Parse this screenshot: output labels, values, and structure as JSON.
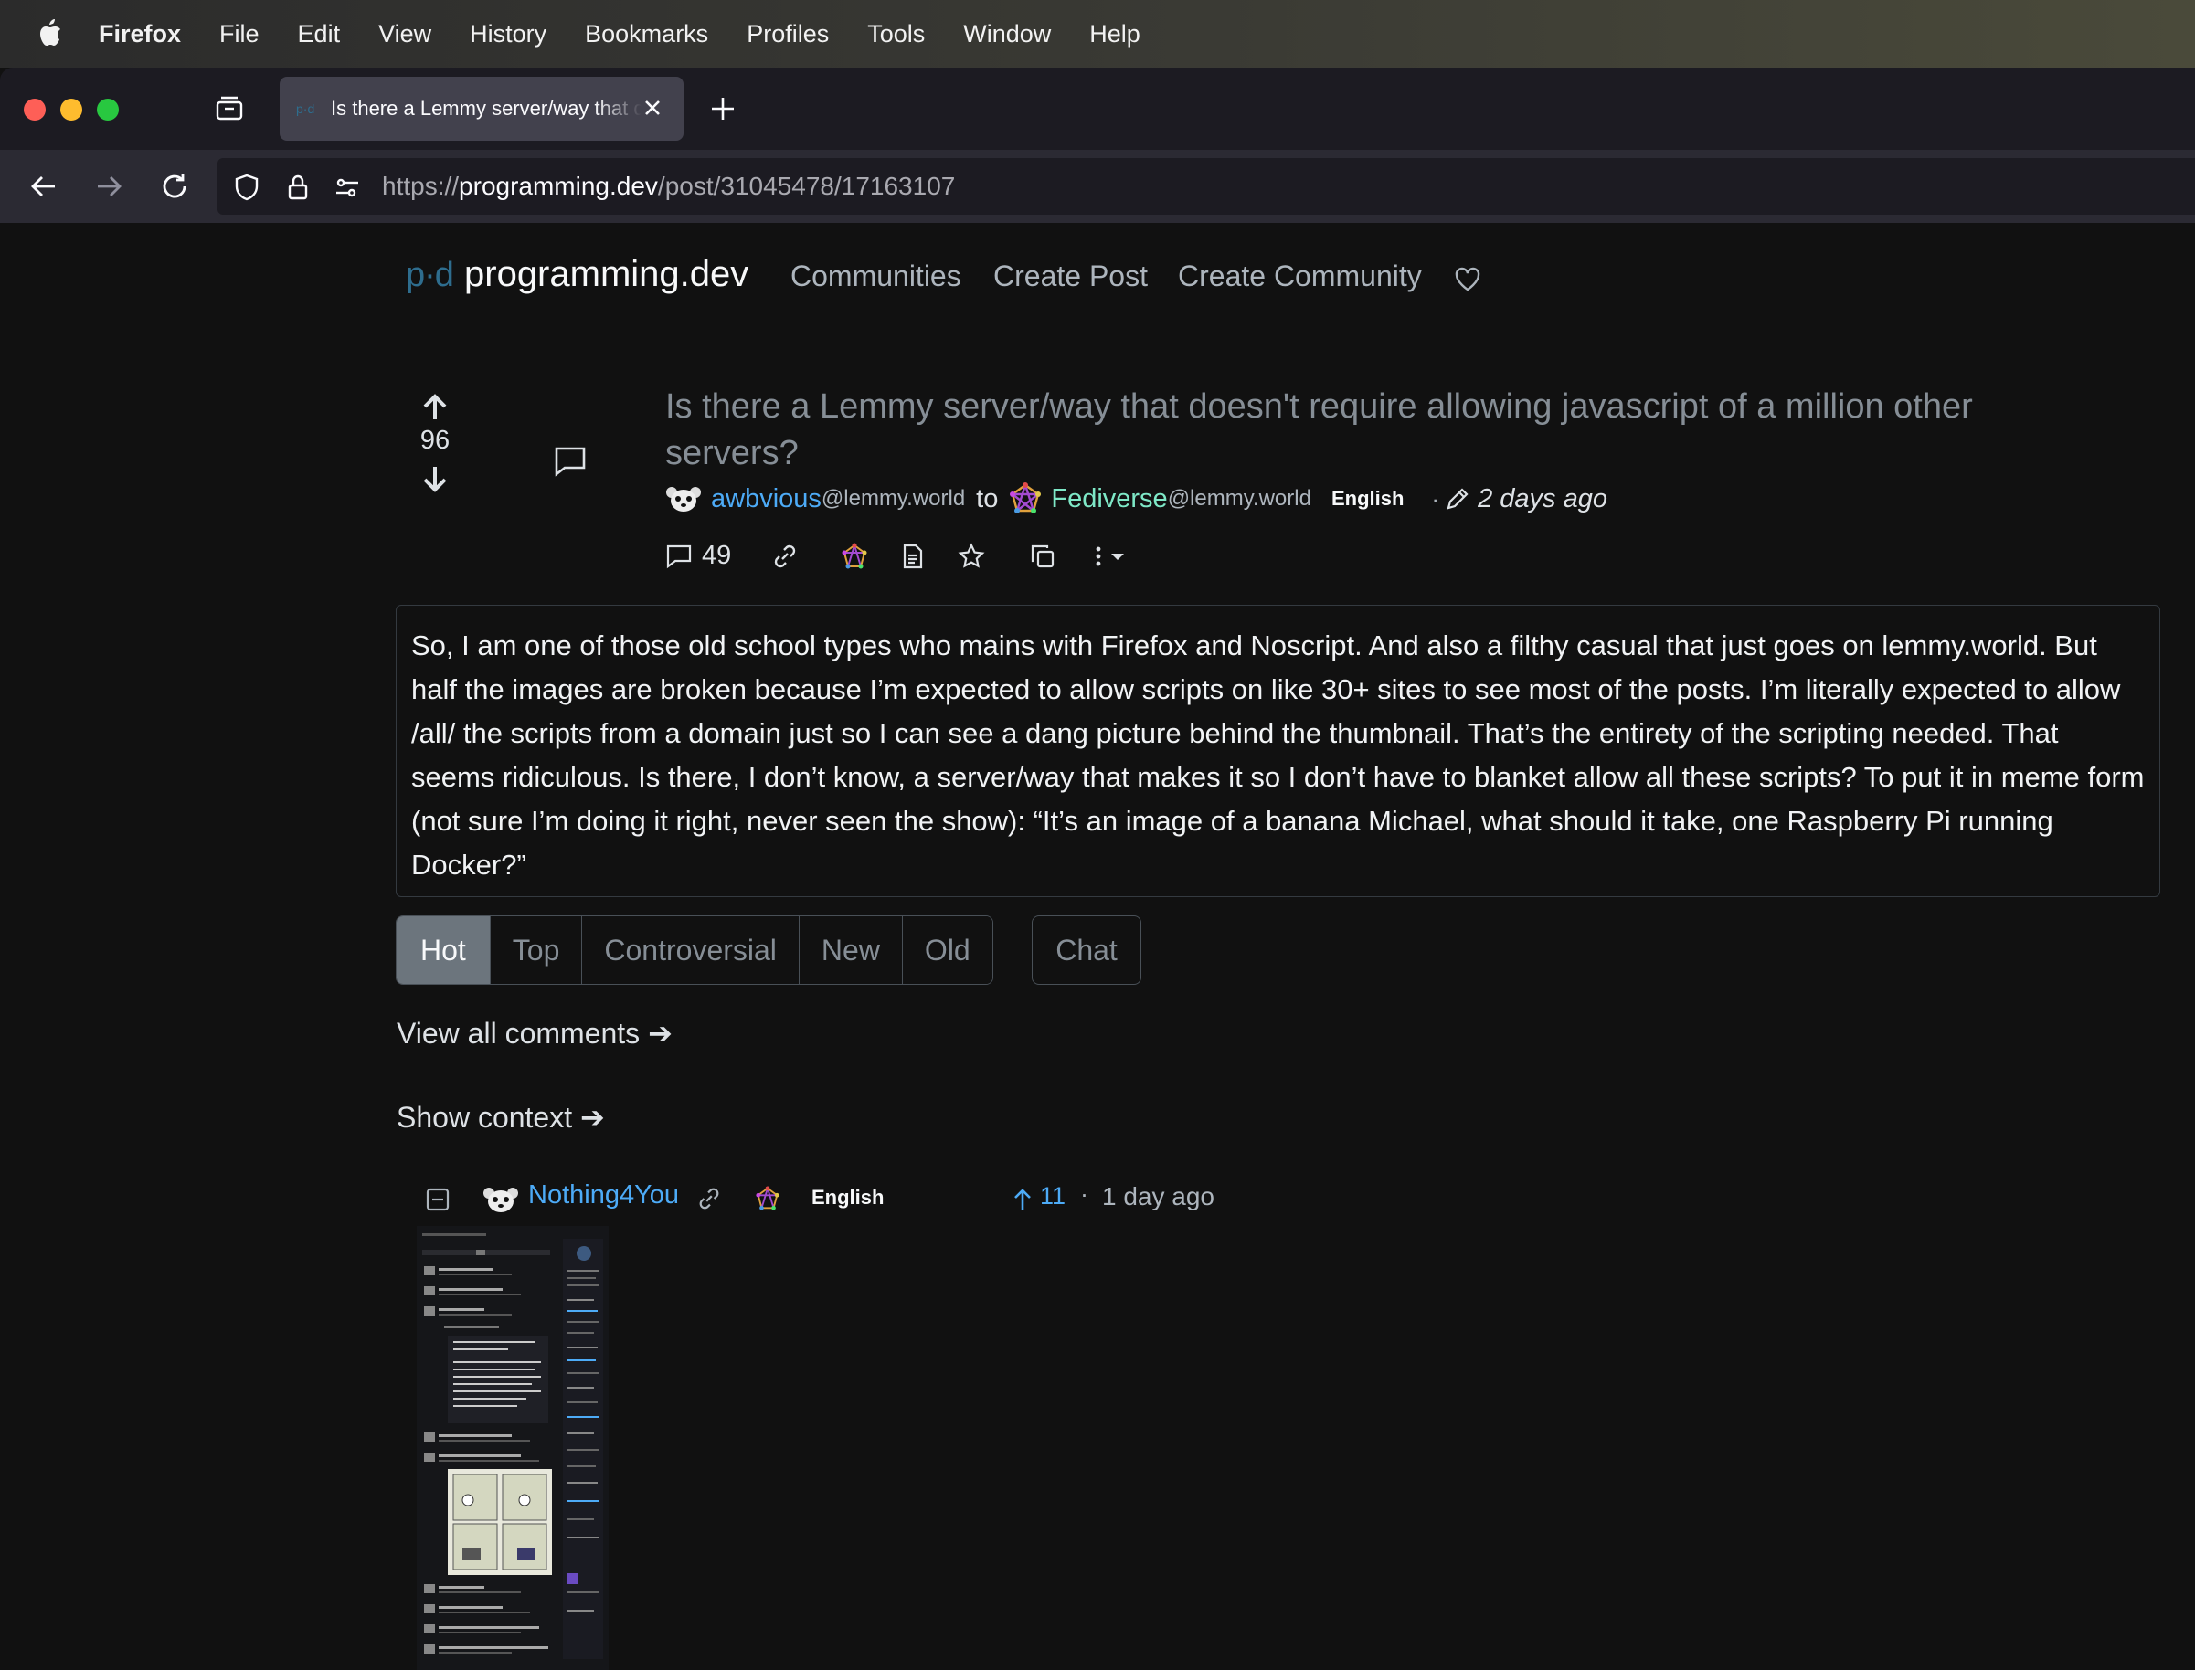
{
  "menubar": {
    "app": "Firefox",
    "items": [
      "File",
      "Edit",
      "View",
      "History",
      "Bookmarks",
      "Profiles",
      "Tools",
      "Window",
      "Help"
    ]
  },
  "tab": {
    "title": "Is there a Lemmy server/way that doesn't require allowing javascript"
  },
  "urlbar": {
    "scheme": "https://",
    "host": "programming.dev",
    "path": "/post/31045478/17163107"
  },
  "site": {
    "logo": "p·d",
    "name": "programming.dev",
    "nav": [
      "Communities",
      "Create Post",
      "Create Community"
    ]
  },
  "post": {
    "score": "96",
    "title": "Is there a Lemmy server/way that doesn't require allowing javascript of a million other servers?",
    "author": "awbvious",
    "author_instance": "@lemmy.world",
    "to": "to",
    "community": "Fediverse",
    "community_instance": "@lemmy.world",
    "language": "English",
    "dot": "·",
    "time": "2 days ago",
    "comment_count": "49",
    "body": "So, I am one of those old school types who mains with Firefox and Noscript. And also a filthy casual that just goes on lemmy.world. But half the images are broken because I’m expected to allow scripts on like 30+ sites to see most of the posts. I’m literally expected to allow /all/ the scripts from a domain just so I can see a dang picture behind the thumbnail. That’s the entirety of the scripting needed. That seems ridiculous. Is there, I don’t know, a server/way that makes it so I don’t have to blanket allow all these scripts? To put it in meme form (not sure I’m doing it right, never seen the show): “It’s an image of a banana Michael, what should it take, one Raspberry Pi running Docker?”"
  },
  "sort": {
    "options": [
      "Hot",
      "Top",
      "Controversial",
      "New",
      "Old"
    ],
    "chat": "Chat"
  },
  "links": {
    "view_all": "View all comments ➔",
    "show_context": "Show context ➔"
  },
  "comment": {
    "author": "Nothing4You",
    "language": "English",
    "score": "11",
    "dot": "·",
    "time": "1 day ago"
  },
  "colors": {
    "link_blue": "#4dabf7",
    "community_green": "#7ee8c7",
    "bg": "#111111"
  },
  "icons": [
    "apple-icon",
    "tabs-icon",
    "close-icon",
    "plus-icon",
    "back-icon",
    "forward-icon",
    "reload-icon",
    "shield-icon",
    "lock-icon",
    "permissions-icon",
    "heart-icon",
    "upvote-icon",
    "downvote-icon",
    "comment-icon",
    "link-icon",
    "fediverse-icon",
    "source-icon",
    "star-icon",
    "copy-icon",
    "more-icon",
    "collapse-icon"
  ]
}
